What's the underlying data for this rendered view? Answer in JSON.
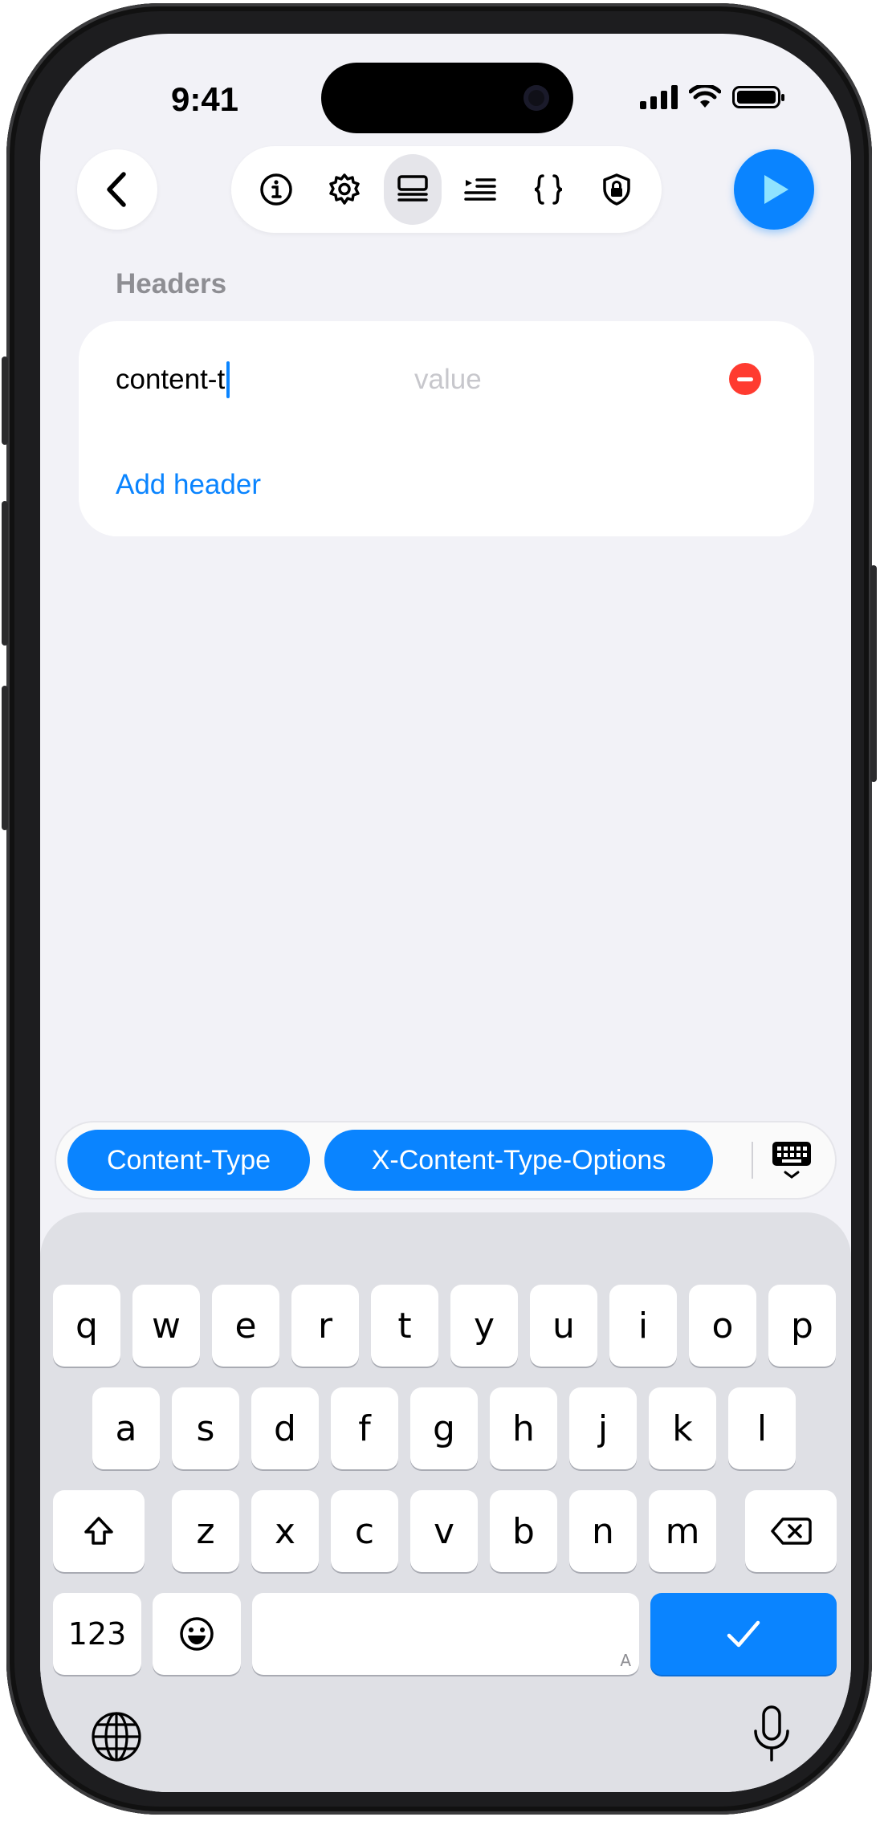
{
  "status": {
    "time": "9:41"
  },
  "toolbar": {
    "back_icon": "chevron-left-icon",
    "items": [
      {
        "icon": "info-icon",
        "active": false
      },
      {
        "icon": "gear-icon",
        "active": false
      },
      {
        "icon": "headers-list-icon",
        "active": true
      },
      {
        "icon": "params-list-icon",
        "active": false
      },
      {
        "icon": "braces-icon",
        "active": false
      },
      {
        "icon": "lock-shield-icon",
        "active": false
      }
    ],
    "run_icon": "play-icon"
  },
  "section": {
    "title": "Headers"
  },
  "header_row": {
    "key": "content-t",
    "value_placeholder": "value"
  },
  "add_header_label": "Add header",
  "suggestions": [
    "Content-Type",
    "X-Content-Type-Options"
  ],
  "keyboard": {
    "row1": [
      "q",
      "w",
      "e",
      "r",
      "t",
      "y",
      "u",
      "i",
      "o",
      "p"
    ],
    "row2": [
      "a",
      "s",
      "d",
      "f",
      "g",
      "h",
      "j",
      "k",
      "l"
    ],
    "row3": [
      "z",
      "x",
      "c",
      "v",
      "b",
      "n",
      "m"
    ],
    "numbers_label": "123",
    "space_hint": "A"
  },
  "colors": {
    "accent": "#0a84ff",
    "destructive": "#ff3b30",
    "background": "#f2f2f7"
  }
}
